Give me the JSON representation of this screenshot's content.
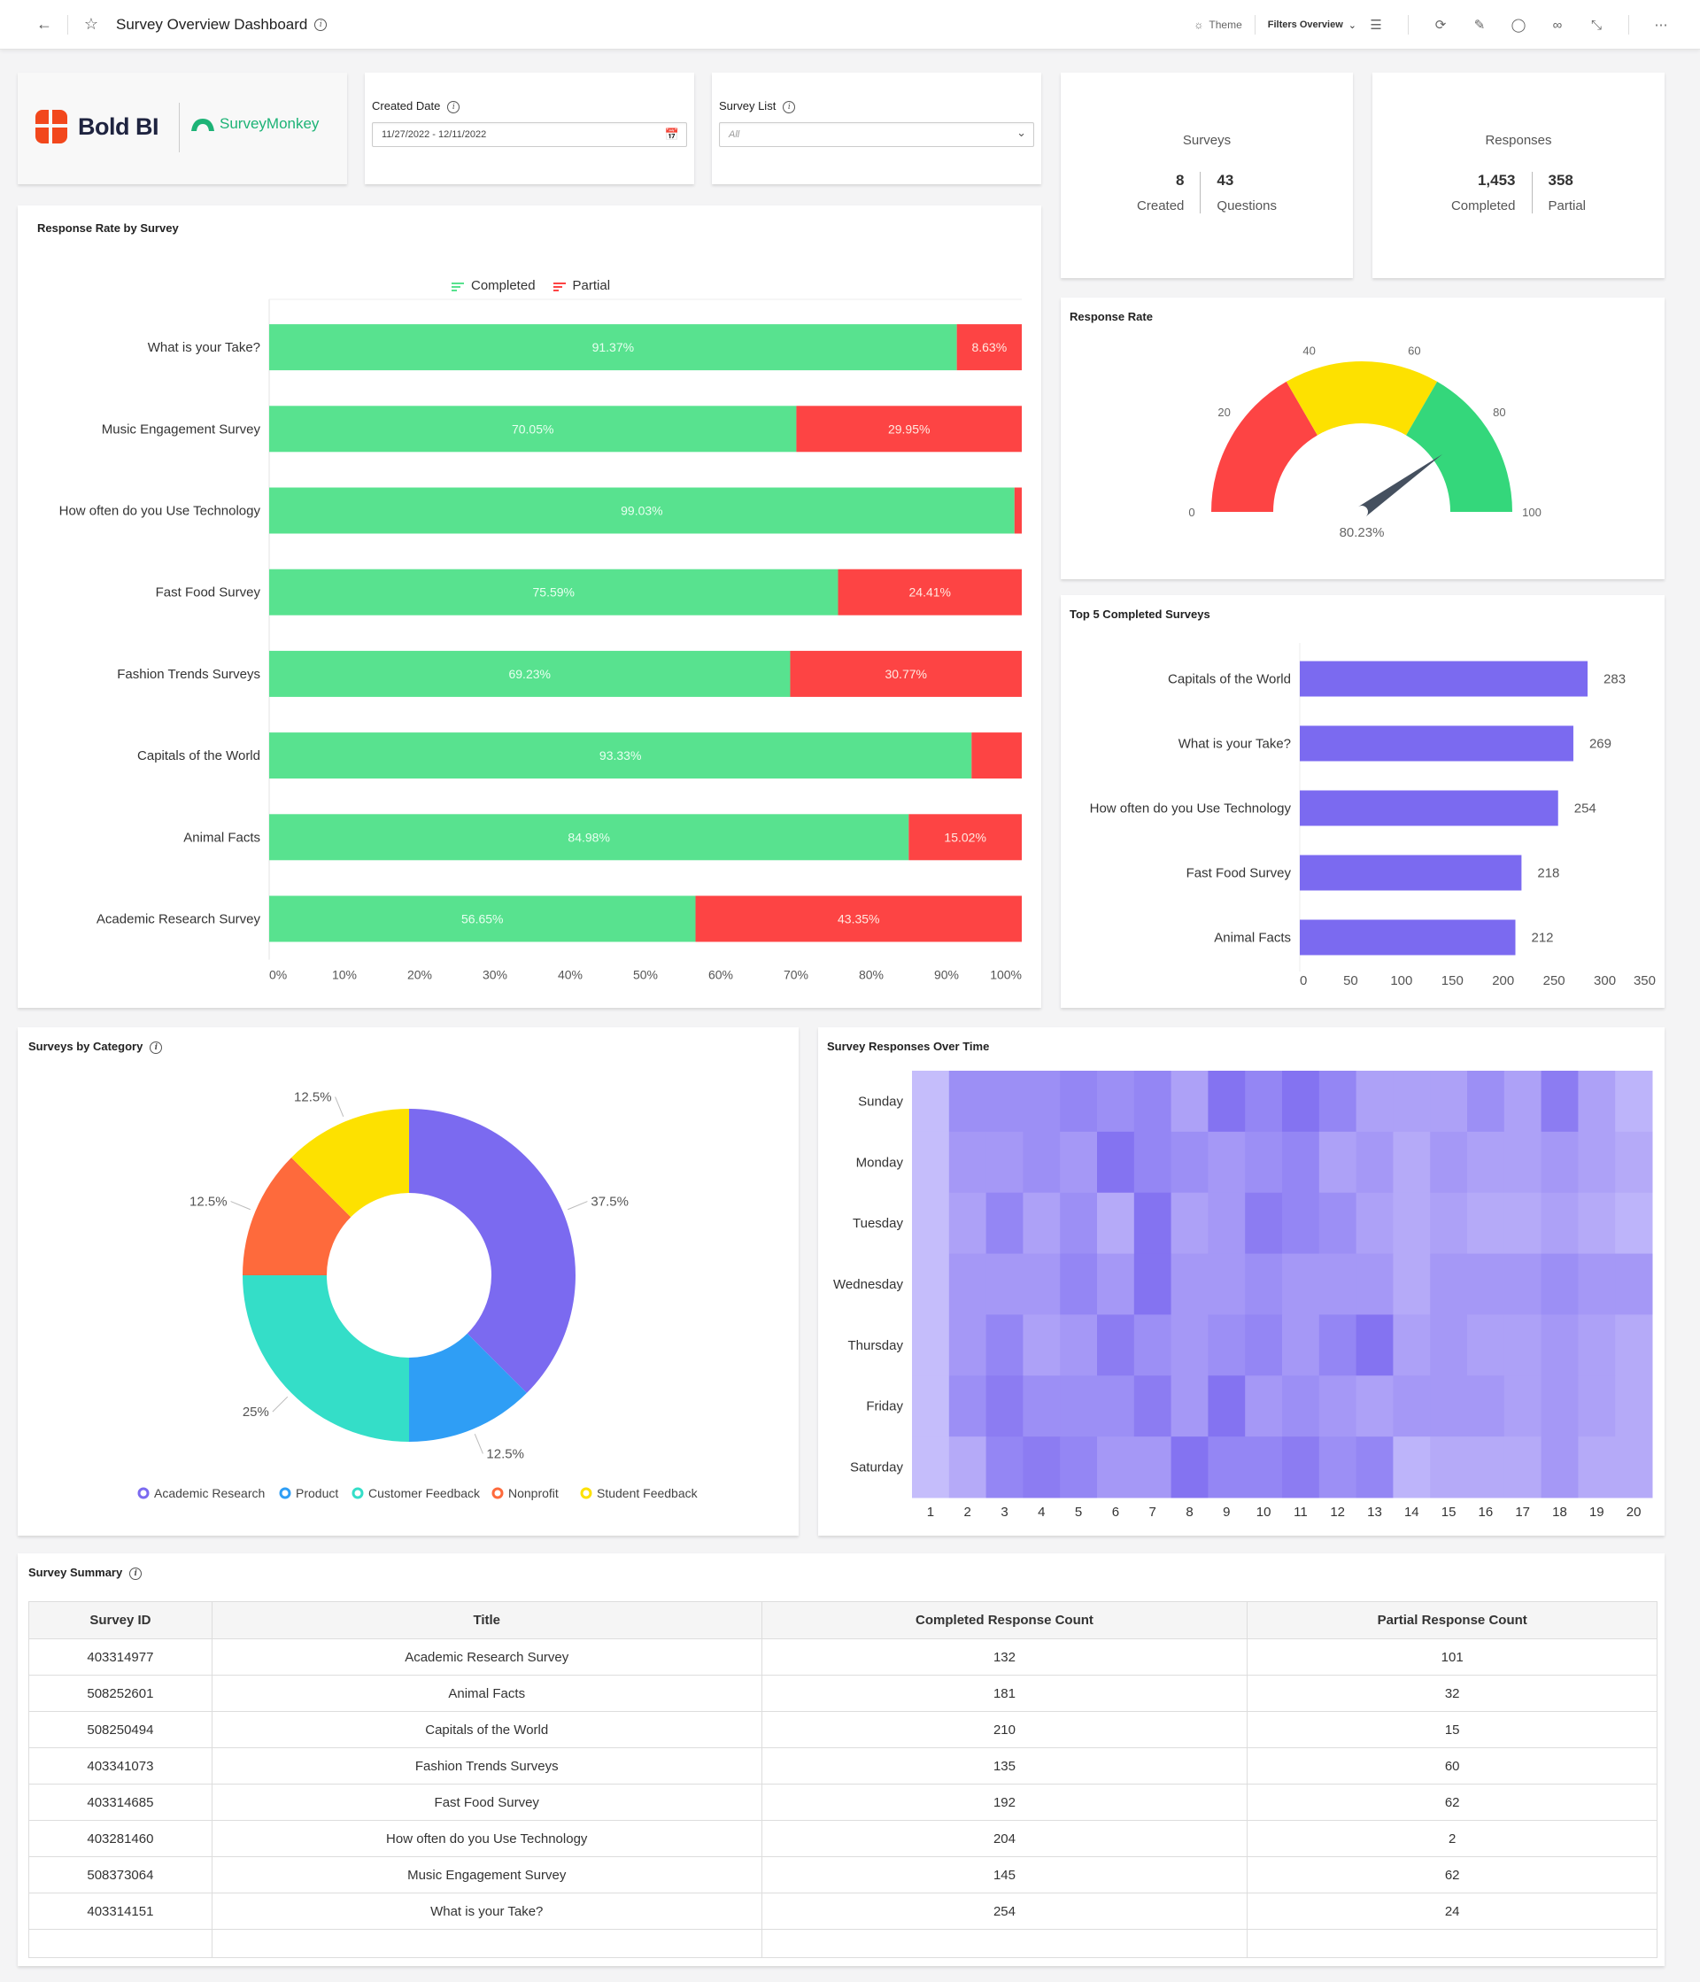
{
  "header": {
    "title": "Survey Overview Dashboard",
    "theme_label": "Theme",
    "filters_label": "Filters Overview",
    "icons": [
      "back-icon",
      "favorite-star-icon",
      "info-icon",
      "theme-icon",
      "filter-settings-icon",
      "refresh-icon",
      "edit-icon",
      "comment-icon",
      "view-icon",
      "fullscreen-icon",
      "more-icon"
    ]
  },
  "logos": {
    "primary": "Bold BI",
    "secondary": "SurveyMonkey"
  },
  "filters": {
    "created_date": {
      "label": "Created Date",
      "value": "11/27/2022 - 12/11/2022"
    },
    "survey_list": {
      "label": "Survey List",
      "value": "All"
    }
  },
  "kpis": {
    "surveys": {
      "title": "Surveys",
      "left_value": "8",
      "left_label": "Created",
      "right_value": "43",
      "right_label": "Questions"
    },
    "responses": {
      "title": "Responses",
      "left_value": "1,453",
      "left_label": "Completed",
      "right_value": "358",
      "right_label": "Partial"
    }
  },
  "colors": {
    "completed": "#58e28f",
    "partial": "#fd4444",
    "purple": "#7b6af0",
    "gauge_red": "#fd4444",
    "gauge_yellow": "#fde100",
    "gauge_green": "#34d77b"
  },
  "chart_data": [
    {
      "id": "response_rate_by_survey",
      "type": "bar",
      "stacked": "100%",
      "orientation": "horizontal",
      "title": "Response Rate by Survey",
      "categories": [
        "What is your Take?",
        "Music Engagement Survey",
        "How often do you Use Technology",
        "Fast Food Survey",
        "Fashion Trends Surveys",
        "Capitals of the World",
        "Animal Facts",
        "Academic Research Survey"
      ],
      "series": [
        {
          "name": "Completed",
          "values": [
            91.37,
            70.05,
            99.03,
            75.59,
            69.23,
            93.33,
            84.98,
            56.65
          ],
          "labels": [
            "91.37%",
            "70.05%",
            "99.03%",
            "75.59%",
            "69.23%",
            "93.33%",
            "84.98%",
            "56.65%"
          ]
        },
        {
          "name": "Partial",
          "values": [
            8.63,
            29.95,
            0.97,
            24.41,
            30.77,
            6.67,
            15.02,
            43.35
          ],
          "labels": [
            "8.63%",
            "29.95%",
            "",
            "24.41%",
            "30.77%",
            "",
            "15.02%",
            "43.35%"
          ]
        }
      ],
      "xticks": [
        "0%",
        "10%",
        "20%",
        "30%",
        "40%",
        "50%",
        "60%",
        "70%",
        "80%",
        "90%",
        "100%"
      ],
      "xlim": [
        0,
        100
      ],
      "legend": "top-center"
    },
    {
      "id": "response_rate_gauge",
      "type": "gauge",
      "title": "Response Rate",
      "value": 80.23,
      "value_label": "80.23%",
      "range": [
        0,
        100
      ],
      "bands": [
        {
          "from": 0,
          "to": 33.3,
          "color": "red"
        },
        {
          "from": 33.3,
          "to": 66.7,
          "color": "yellow"
        },
        {
          "from": 66.7,
          "to": 100,
          "color": "green"
        }
      ],
      "ticks": [
        "0",
        "20",
        "40",
        "60",
        "80",
        "100"
      ]
    },
    {
      "id": "top5_completed",
      "type": "bar",
      "orientation": "horizontal",
      "title": "Top 5 Completed Surveys",
      "categories": [
        "Capitals of the World",
        "What is your Take?",
        "How often do you Use Technology",
        "Fast Food Survey",
        "Animal Facts"
      ],
      "values": [
        283,
        269,
        254,
        218,
        212
      ],
      "xticks": [
        "0",
        "50",
        "100",
        "150",
        "200",
        "250",
        "300",
        "350"
      ],
      "xlim": [
        0,
        350
      ]
    },
    {
      "id": "surveys_by_category",
      "type": "pie",
      "donut": true,
      "title": "Surveys by Category",
      "categories": [
        "Academic Research",
        "Product",
        "Customer Feedback",
        "Nonprofit",
        "Student Feedback"
      ],
      "values": [
        37.5,
        12.5,
        25,
        12.5,
        12.5
      ],
      "labels": [
        "37.5%",
        "12.5%",
        "25%",
        "12.5%",
        "12.5%"
      ],
      "colors": [
        "#7b6af0",
        "#2f9ef5",
        "#34dec8",
        "#fe6a3c",
        "#fde100"
      ],
      "legend": "bottom"
    },
    {
      "id": "survey_responses_over_time",
      "type": "heatmap",
      "title": "Survey Responses Over Time",
      "y": [
        "Sunday",
        "Monday",
        "Tuesday",
        "Wednesday",
        "Thursday",
        "Friday",
        "Saturday"
      ],
      "x": [
        "1",
        "2",
        "3",
        "4",
        "5",
        "6",
        "7",
        "8",
        "9",
        "10",
        "11",
        "12",
        "13",
        "14",
        "15",
        "16",
        "17",
        "18",
        "19",
        "20"
      ],
      "intensity_note": "relative intensity 0-1 estimated from color",
      "values": [
        [
          0.1,
          0.6,
          0.6,
          0.6,
          0.7,
          0.6,
          0.7,
          0.4,
          0.9,
          0.7,
          0.9,
          0.7,
          0.4,
          0.4,
          0.4,
          0.6,
          0.4,
          0.8,
          0.4,
          0.2
        ],
        [
          0.1,
          0.5,
          0.5,
          0.6,
          0.5,
          0.9,
          0.7,
          0.6,
          0.5,
          0.6,
          0.7,
          0.4,
          0.5,
          0.3,
          0.5,
          0.4,
          0.4,
          0.5,
          0.4,
          0.3
        ],
        [
          0.1,
          0.4,
          0.7,
          0.4,
          0.6,
          0.3,
          0.9,
          0.4,
          0.5,
          0.8,
          0.7,
          0.6,
          0.4,
          0.3,
          0.4,
          0.3,
          0.3,
          0.4,
          0.3,
          0.2
        ],
        [
          0.1,
          0.5,
          0.5,
          0.5,
          0.7,
          0.5,
          0.9,
          0.5,
          0.5,
          0.6,
          0.5,
          0.5,
          0.5,
          0.3,
          0.5,
          0.5,
          0.5,
          0.6,
          0.5,
          0.5
        ],
        [
          0.1,
          0.5,
          0.7,
          0.4,
          0.5,
          0.8,
          0.6,
          0.5,
          0.6,
          0.7,
          0.5,
          0.7,
          0.9,
          0.4,
          0.5,
          0.4,
          0.4,
          0.5,
          0.4,
          0.3
        ],
        [
          0.1,
          0.6,
          0.8,
          0.6,
          0.6,
          0.6,
          0.8,
          0.5,
          0.9,
          0.5,
          0.6,
          0.5,
          0.4,
          0.5,
          0.5,
          0.5,
          0.4,
          0.5,
          0.4,
          0.3
        ],
        [
          0.1,
          0.3,
          0.7,
          0.8,
          0.7,
          0.5,
          0.5,
          0.9,
          0.7,
          0.7,
          0.8,
          0.6,
          0.7,
          0.2,
          0.3,
          0.3,
          0.3,
          0.5,
          0.3,
          0.3
        ]
      ]
    }
  ],
  "summary_table": {
    "title": "Survey Summary",
    "columns": [
      "Survey ID",
      "Title",
      "Completed Response Count",
      "Partial Response Count"
    ],
    "rows": [
      [
        "403314977",
        "Academic Research Survey",
        "132",
        "101"
      ],
      [
        "508252601",
        "Animal Facts",
        "181",
        "32"
      ],
      [
        "508250494",
        "Capitals of the World",
        "210",
        "15"
      ],
      [
        "403341073",
        "Fashion Trends Surveys",
        "135",
        "60"
      ],
      [
        "403314685",
        "Fast Food Survey",
        "192",
        "62"
      ],
      [
        "403281460",
        "How often do you Use Technology",
        "204",
        "2"
      ],
      [
        "508373064",
        "Music Engagement Survey",
        "145",
        "62"
      ],
      [
        "403314151",
        "What is your Take?",
        "254",
        "24"
      ]
    ]
  }
}
